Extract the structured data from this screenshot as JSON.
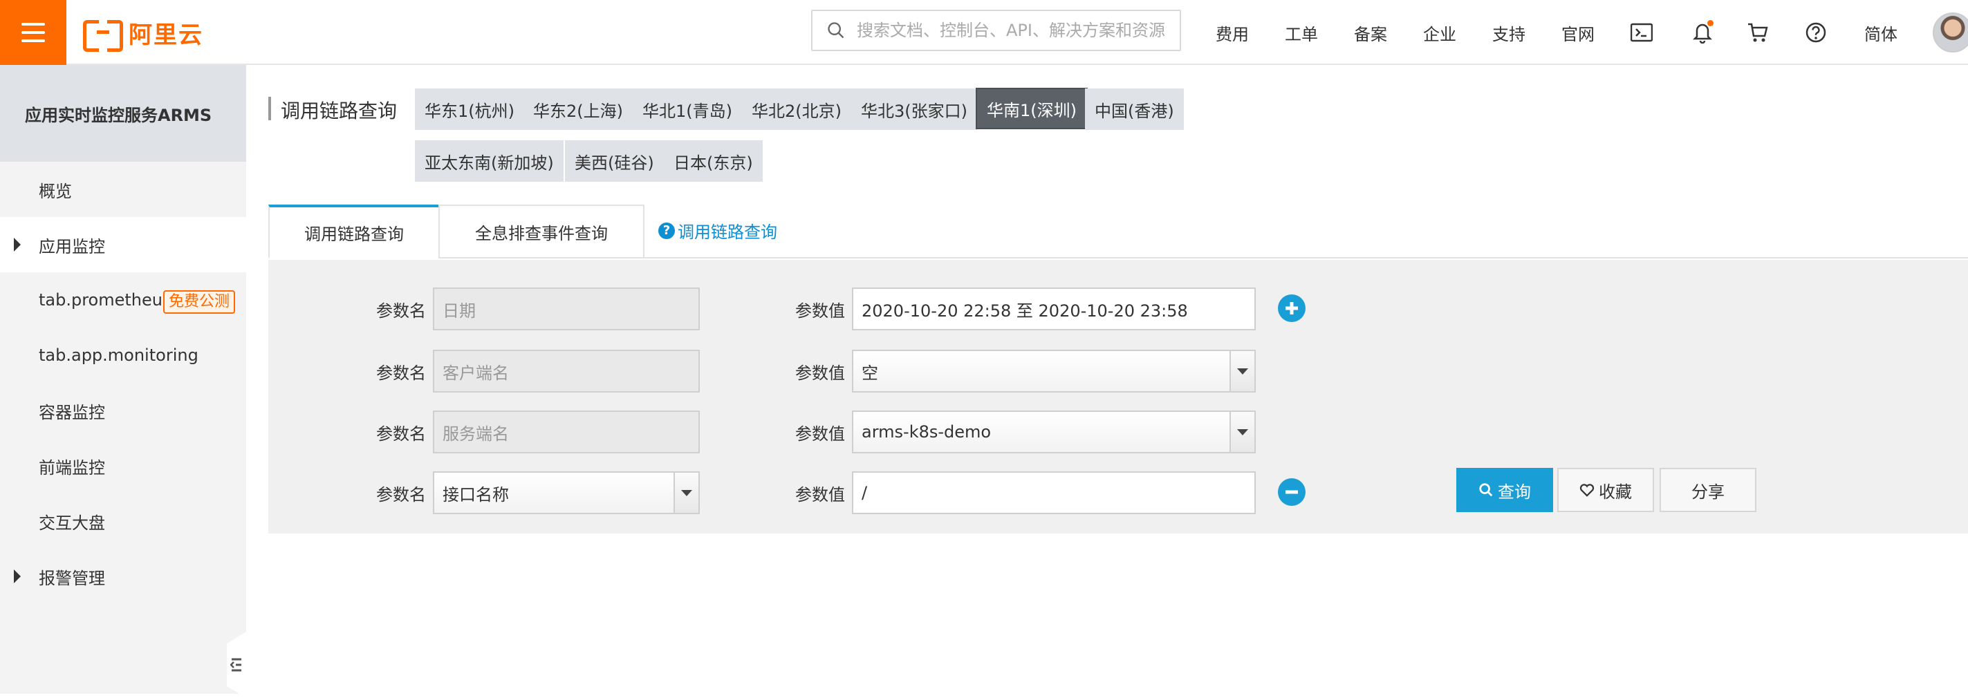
{
  "header": {
    "logo_text": "阿里云",
    "search_placeholder": "搜索文档、控制台、API、解决方案和资源",
    "nav": [
      "费用",
      "工单",
      "备案",
      "企业",
      "支持",
      "官网"
    ],
    "language": "简体",
    "icons": [
      "menu-icon",
      "search-icon",
      "terminal-icon",
      "bell-icon",
      "cart-icon",
      "help-icon"
    ],
    "accent_color": "#ff6a00"
  },
  "sidebar": {
    "title": "应用实时监控服务ARMS",
    "items": [
      {
        "label": "概览"
      },
      {
        "label": "应用监控"
      },
      {
        "label": "tab.prometheus.monit",
        "badge": "免费公测"
      },
      {
        "label": "tab.app.monitoring"
      },
      {
        "label": "容器监控"
      },
      {
        "label": "前端监控"
      },
      {
        "label": "交互大盘"
      },
      {
        "label": "报警管理"
      }
    ]
  },
  "page": {
    "title": "调用链路查询",
    "regions": [
      "华东1(杭州)",
      "华东2(上海)",
      "华北1(青岛)",
      "华北2(北京)",
      "华北3(张家口)",
      "华南1(深圳)",
      "中国(香港)",
      "亚太东南(新加坡)",
      "美西(硅谷)",
      "日本(东京)"
    ],
    "active_region": "华南1(深圳)",
    "tabs": [
      "调用链路查询",
      "全息排查事件查询"
    ],
    "help_link": "调用链路查询"
  },
  "query": {
    "param_name_label": "参数名",
    "param_value_label": "参数值",
    "rows": [
      {
        "name": "日期",
        "value": "2020-10-20 22:58 至 2020-10-20 23:58"
      },
      {
        "name": "客户端名",
        "value": "空"
      },
      {
        "name": "服务端名",
        "value": "arms-k8s-demo"
      },
      {
        "name": "接口名称",
        "value": "/"
      }
    ],
    "search_button": "查询",
    "favorite_button": "收藏",
    "share_button": "分享",
    "primary_color": "#1a9ed6"
  }
}
